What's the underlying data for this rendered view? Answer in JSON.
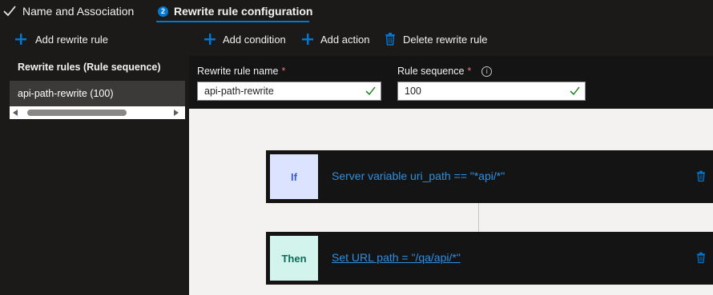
{
  "tabs": [
    {
      "label": "Name and Association"
    },
    {
      "step": "2",
      "label": "Rewrite rule configuration"
    }
  ],
  "sidebar": {
    "add_label": "Add rewrite rule",
    "heading": "Rewrite rules (Rule sequence)",
    "items": [
      {
        "label": "api-path-rewrite (100)"
      }
    ]
  },
  "toolbar": {
    "add_condition": "Add condition",
    "add_action": "Add action",
    "delete_rule": "Delete rewrite rule"
  },
  "form": {
    "name_label": "Rewrite rule name",
    "name_value": "api-path-rewrite",
    "sequence_label": "Rule sequence",
    "sequence_value": "100",
    "required_mark": "*",
    "info_glyph": "i"
  },
  "conditions": {
    "if_label": "If",
    "if_text": "Server variable uri_path == \"*api/*\"",
    "then_label": "Then",
    "then_text": "Set URL path = \"/qa/api/*\""
  },
  "icons": {
    "check": "check-icon",
    "plus": "plus-icon",
    "trash": "trash-icon",
    "info": "info-icon"
  },
  "colors": {
    "accent": "#0078d4",
    "link": "#2f8fe0",
    "success": "#107c10",
    "required": "#f1707b"
  }
}
